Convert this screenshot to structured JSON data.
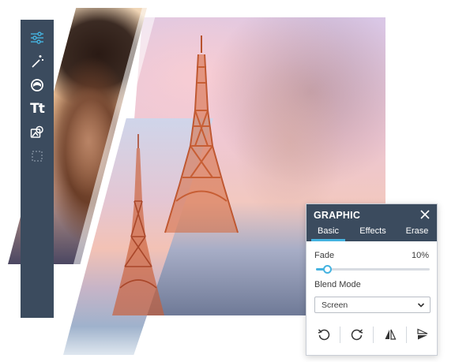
{
  "toolbar": {
    "tools": [
      {
        "name": "adjust",
        "icon": "sliders-icon"
      },
      {
        "name": "effects",
        "icon": "magic-wand-icon"
      },
      {
        "name": "touch-up",
        "icon": "face-icon"
      },
      {
        "name": "text",
        "icon": "text-icon",
        "label": "Tt"
      },
      {
        "name": "graphics",
        "icon": "graphics-icon"
      },
      {
        "name": "frames",
        "icon": "frame-icon"
      }
    ]
  },
  "panel": {
    "title": "GRAPHIC",
    "tabs": [
      {
        "label": "Basic",
        "active": true
      },
      {
        "label": "Effects",
        "active": false
      },
      {
        "label": "Erase",
        "active": false
      }
    ],
    "fade": {
      "label": "Fade",
      "value_text": "10%",
      "value": 10
    },
    "blend": {
      "label": "Blend Mode",
      "selected": "Screen"
    },
    "actions": [
      {
        "name": "rotate-left",
        "icon": "rotate-left-icon"
      },
      {
        "name": "rotate-right",
        "icon": "rotate-right-icon"
      },
      {
        "name": "flip-horizontal",
        "icon": "flip-horizontal-icon"
      },
      {
        "name": "flip-vertical",
        "icon": "flip-vertical-icon"
      }
    ]
  },
  "colors": {
    "sidebar": "#3b4b5e",
    "accent": "#45b3e0",
    "panel_header": "#3b4b5e"
  }
}
